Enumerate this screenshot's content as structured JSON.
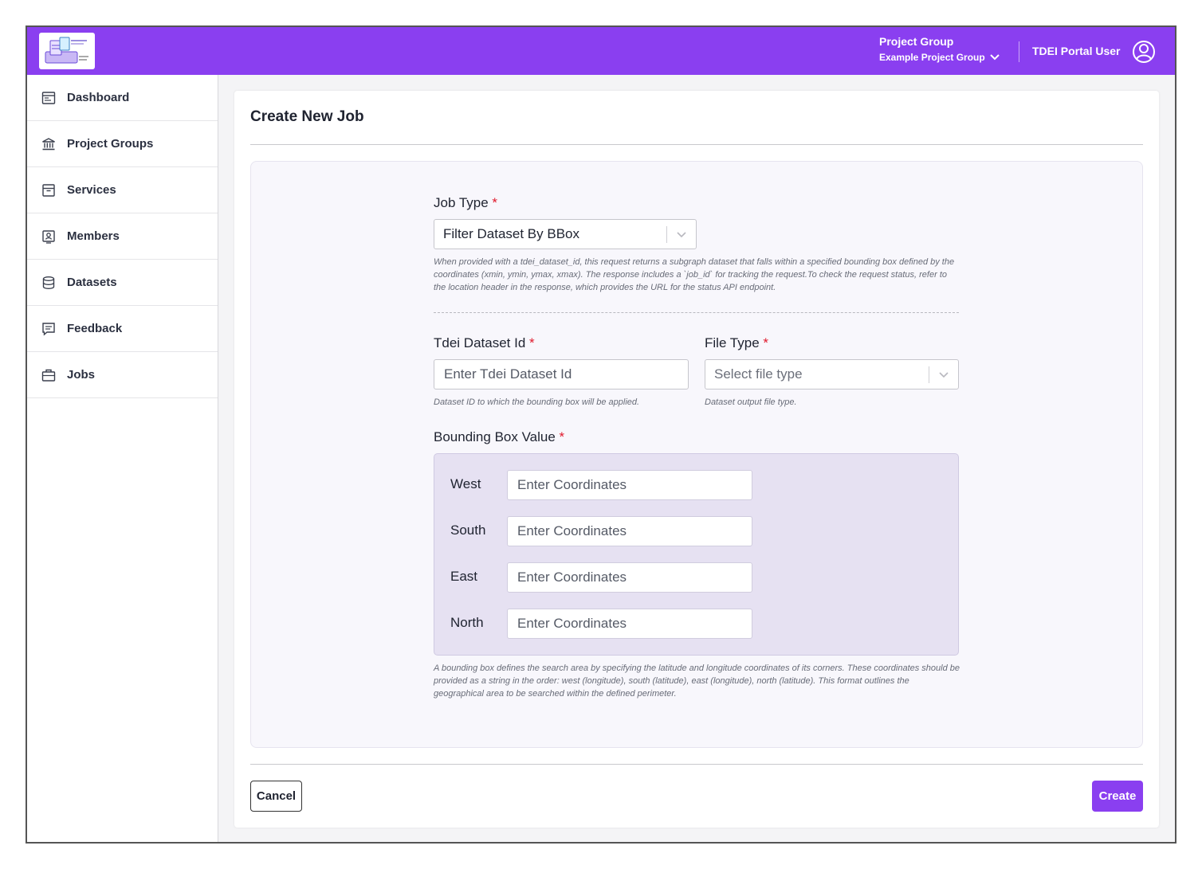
{
  "header": {
    "project_group_label": "Project Group",
    "project_group_value": "Example Project Group",
    "user_name": "TDEI Portal User"
  },
  "sidebar": {
    "items": [
      {
        "label": "Dashboard",
        "icon": "dashboard-icon"
      },
      {
        "label": "Project Groups",
        "icon": "bank-icon"
      },
      {
        "label": "Services",
        "icon": "archive-icon"
      },
      {
        "label": "Members",
        "icon": "member-badge-icon"
      },
      {
        "label": "Datasets",
        "icon": "database-icon"
      },
      {
        "label": "Feedback",
        "icon": "feedback-icon"
      },
      {
        "label": "Jobs",
        "icon": "briefcase-icon"
      }
    ]
  },
  "form": {
    "title": "Create New Job",
    "job_type": {
      "label": "Job Type",
      "required_mark": "*",
      "value": "Filter Dataset By BBox",
      "help": "When provided with a tdei_dataset_id, this request returns a subgraph dataset that falls within a specified bounding box defined by the coordinates (xmin, ymin, ymax, xmax). The response includes a `job_id` for tracking the request.To check the request status, refer to the location header in the response, which provides the URL for the status API endpoint."
    },
    "dataset_id": {
      "label": "Tdei Dataset Id",
      "required_mark": "*",
      "placeholder": "Enter Tdei Dataset Id",
      "help": "Dataset ID to which the bounding box will be applied."
    },
    "file_type": {
      "label": "File Type",
      "required_mark": "*",
      "placeholder": "Select file type",
      "help": "Dataset output file type."
    },
    "bbox": {
      "label": "Bounding Box Value",
      "required_mark": "*",
      "west_label": "West",
      "south_label": "South",
      "east_label": "East",
      "north_label": "North",
      "placeholder": "Enter Coordinates",
      "help": "A bounding box defines the search area by specifying the latitude and longitude coordinates of its corners. These coordinates should be provided as a string in the order: west (longitude), south (latitude), east (longitude), north (latitude). This format outlines the geographical area to be searched within the defined perimeter."
    },
    "cancel_label": "Cancel",
    "create_label": "Create"
  },
  "colors": {
    "accent": "#8a3ff0",
    "required": "#e0192c",
    "bbox_panel": "#e6e1f2"
  }
}
